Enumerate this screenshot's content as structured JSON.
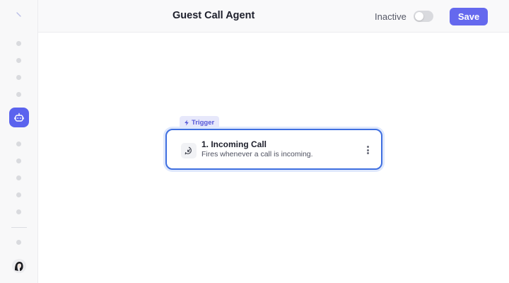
{
  "header": {
    "title": "Guest Call Agent",
    "status_label": "Inactive",
    "toggle_on": false,
    "save_label": "Save"
  },
  "sidebar": {
    "items": [
      {
        "icon": "dot-icon"
      },
      {
        "icon": "dot-icon"
      },
      {
        "icon": "dot-icon"
      },
      {
        "icon": "dot-icon"
      },
      {
        "icon": "bot-icon",
        "active": true
      },
      {
        "icon": "dot-icon"
      },
      {
        "icon": "dot-icon"
      },
      {
        "icon": "dot-icon"
      },
      {
        "icon": "dot-icon"
      },
      {
        "icon": "dot-icon"
      },
      {
        "icon": "dot-icon"
      }
    ],
    "accent_color": "#5b63ee"
  },
  "canvas": {
    "trigger_badge": "Trigger",
    "node": {
      "title": "1. Incoming Call",
      "description": "Fires whenever a call is incoming.",
      "icon": "incoming-call-icon",
      "border_color": "#3f6fe0"
    }
  },
  "colors": {
    "primary": "#6569ee",
    "badge_bg": "#e7e8fb",
    "badge_text": "#5558d8"
  }
}
